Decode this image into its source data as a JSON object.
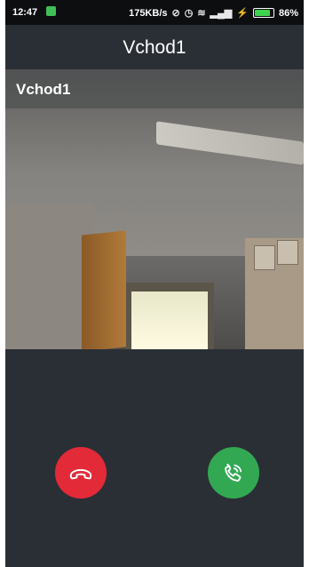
{
  "status_bar": {
    "time": "12:47",
    "net_speed": "175KB/s",
    "battery": "86%",
    "battery_level": 0.86,
    "icons": [
      "app-notification-icon",
      "signal-off-icon",
      "alarm-icon",
      "wifi-icon",
      "cell-signal-icon",
      "charging-icon",
      "battery-icon"
    ]
  },
  "app_bar": {
    "title": "Vchod1"
  },
  "video": {
    "camera_label": "Vchod1"
  },
  "actions": {
    "decline": {
      "icon": "hang-up-icon",
      "color": "#e32a38"
    },
    "accept": {
      "icon": "answer-call-icon",
      "color": "#33a853"
    }
  }
}
